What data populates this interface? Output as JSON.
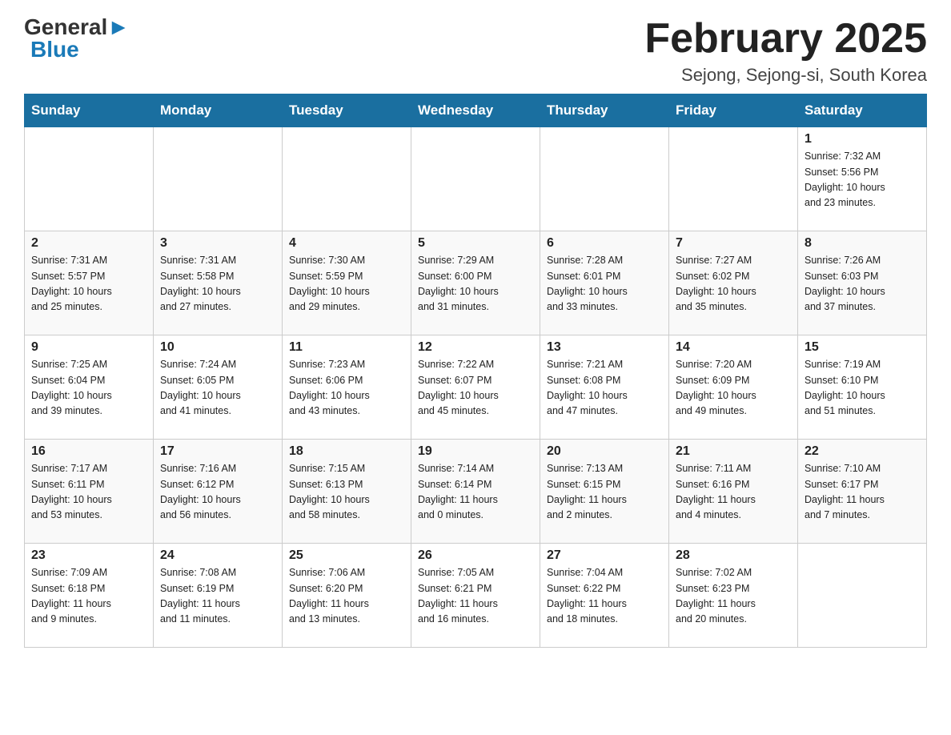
{
  "header": {
    "logo_general": "General",
    "logo_triangle": "▶",
    "logo_blue": "Blue",
    "month_title": "February 2025",
    "location": "Sejong, Sejong-si, South Korea"
  },
  "days_of_week": [
    "Sunday",
    "Monday",
    "Tuesday",
    "Wednesday",
    "Thursday",
    "Friday",
    "Saturday"
  ],
  "weeks": [
    {
      "days": [
        {
          "number": "",
          "info": ""
        },
        {
          "number": "",
          "info": ""
        },
        {
          "number": "",
          "info": ""
        },
        {
          "number": "",
          "info": ""
        },
        {
          "number": "",
          "info": ""
        },
        {
          "number": "",
          "info": ""
        },
        {
          "number": "1",
          "info": "Sunrise: 7:32 AM\nSunset: 5:56 PM\nDaylight: 10 hours\nand 23 minutes."
        }
      ]
    },
    {
      "days": [
        {
          "number": "2",
          "info": "Sunrise: 7:31 AM\nSunset: 5:57 PM\nDaylight: 10 hours\nand 25 minutes."
        },
        {
          "number": "3",
          "info": "Sunrise: 7:31 AM\nSunset: 5:58 PM\nDaylight: 10 hours\nand 27 minutes."
        },
        {
          "number": "4",
          "info": "Sunrise: 7:30 AM\nSunset: 5:59 PM\nDaylight: 10 hours\nand 29 minutes."
        },
        {
          "number": "5",
          "info": "Sunrise: 7:29 AM\nSunset: 6:00 PM\nDaylight: 10 hours\nand 31 minutes."
        },
        {
          "number": "6",
          "info": "Sunrise: 7:28 AM\nSunset: 6:01 PM\nDaylight: 10 hours\nand 33 minutes."
        },
        {
          "number": "7",
          "info": "Sunrise: 7:27 AM\nSunset: 6:02 PM\nDaylight: 10 hours\nand 35 minutes."
        },
        {
          "number": "8",
          "info": "Sunrise: 7:26 AM\nSunset: 6:03 PM\nDaylight: 10 hours\nand 37 minutes."
        }
      ]
    },
    {
      "days": [
        {
          "number": "9",
          "info": "Sunrise: 7:25 AM\nSunset: 6:04 PM\nDaylight: 10 hours\nand 39 minutes."
        },
        {
          "number": "10",
          "info": "Sunrise: 7:24 AM\nSunset: 6:05 PM\nDaylight: 10 hours\nand 41 minutes."
        },
        {
          "number": "11",
          "info": "Sunrise: 7:23 AM\nSunset: 6:06 PM\nDaylight: 10 hours\nand 43 minutes."
        },
        {
          "number": "12",
          "info": "Sunrise: 7:22 AM\nSunset: 6:07 PM\nDaylight: 10 hours\nand 45 minutes."
        },
        {
          "number": "13",
          "info": "Sunrise: 7:21 AM\nSunset: 6:08 PM\nDaylight: 10 hours\nand 47 minutes."
        },
        {
          "number": "14",
          "info": "Sunrise: 7:20 AM\nSunset: 6:09 PM\nDaylight: 10 hours\nand 49 minutes."
        },
        {
          "number": "15",
          "info": "Sunrise: 7:19 AM\nSunset: 6:10 PM\nDaylight: 10 hours\nand 51 minutes."
        }
      ]
    },
    {
      "days": [
        {
          "number": "16",
          "info": "Sunrise: 7:17 AM\nSunset: 6:11 PM\nDaylight: 10 hours\nand 53 minutes."
        },
        {
          "number": "17",
          "info": "Sunrise: 7:16 AM\nSunset: 6:12 PM\nDaylight: 10 hours\nand 56 minutes."
        },
        {
          "number": "18",
          "info": "Sunrise: 7:15 AM\nSunset: 6:13 PM\nDaylight: 10 hours\nand 58 minutes."
        },
        {
          "number": "19",
          "info": "Sunrise: 7:14 AM\nSunset: 6:14 PM\nDaylight: 11 hours\nand 0 minutes."
        },
        {
          "number": "20",
          "info": "Sunrise: 7:13 AM\nSunset: 6:15 PM\nDaylight: 11 hours\nand 2 minutes."
        },
        {
          "number": "21",
          "info": "Sunrise: 7:11 AM\nSunset: 6:16 PM\nDaylight: 11 hours\nand 4 minutes."
        },
        {
          "number": "22",
          "info": "Sunrise: 7:10 AM\nSunset: 6:17 PM\nDaylight: 11 hours\nand 7 minutes."
        }
      ]
    },
    {
      "days": [
        {
          "number": "23",
          "info": "Sunrise: 7:09 AM\nSunset: 6:18 PM\nDaylight: 11 hours\nand 9 minutes."
        },
        {
          "number": "24",
          "info": "Sunrise: 7:08 AM\nSunset: 6:19 PM\nDaylight: 11 hours\nand 11 minutes."
        },
        {
          "number": "25",
          "info": "Sunrise: 7:06 AM\nSunset: 6:20 PM\nDaylight: 11 hours\nand 13 minutes."
        },
        {
          "number": "26",
          "info": "Sunrise: 7:05 AM\nSunset: 6:21 PM\nDaylight: 11 hours\nand 16 minutes."
        },
        {
          "number": "27",
          "info": "Sunrise: 7:04 AM\nSunset: 6:22 PM\nDaylight: 11 hours\nand 18 minutes."
        },
        {
          "number": "28",
          "info": "Sunrise: 7:02 AM\nSunset: 6:23 PM\nDaylight: 11 hours\nand 20 minutes."
        },
        {
          "number": "",
          "info": ""
        }
      ]
    }
  ]
}
